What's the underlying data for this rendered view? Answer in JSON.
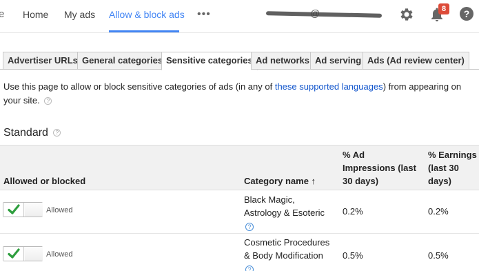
{
  "nav": {
    "brand_tail": "e",
    "items": [
      "Home",
      "My ads",
      "Allow & block ads"
    ],
    "active_index": 2,
    "more": "•••",
    "account_at": "@",
    "notifications_count": "8",
    "accent": "#4285f4"
  },
  "tabs": [
    "Advertiser URLs",
    "General categories",
    "Sensitive categories",
    "Ad networks",
    "Ad serving",
    "Ads (Ad review center)"
  ],
  "active_tab": "Sensitive categories",
  "intro": {
    "text_before": "Use this page to allow or block sensitive categories of ads (in any of ",
    "link": "these supported languages",
    "text_after": ") from appearing on your site.",
    "help": "?"
  },
  "section": {
    "title": "Standard",
    "help": "?"
  },
  "table": {
    "headers": {
      "allowed": "Allowed or blocked",
      "category": "Category name",
      "sort_icon": "↑",
      "impressions": "% Ad Impressions (last 30 days)",
      "earnings": "% Earnings (last 30 days)"
    },
    "rows": [
      {
        "state": "Allowed",
        "category": "Black Magic, Astrology & Esoteric",
        "help": "?",
        "impressions": "0.2%",
        "earnings": "0.2%"
      },
      {
        "state": "Allowed",
        "category": "Cosmetic Procedures & Body Modification",
        "help": "?",
        "impressions": "0.5%",
        "earnings": "0.5%"
      }
    ]
  },
  "icons": [
    "gear-icon",
    "bell-icon",
    "help-icon",
    "check-icon",
    "sort-arrow-icon"
  ]
}
